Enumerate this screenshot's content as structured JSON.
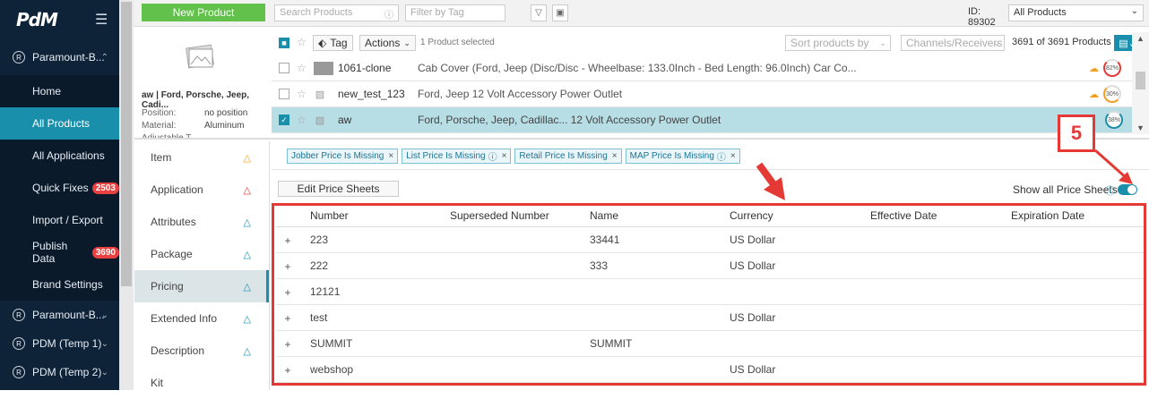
{
  "brand": {
    "logo": "PdM"
  },
  "sidebar": {
    "accounts": [
      {
        "label": "Paramount-B..."
      },
      {
        "label": "Paramount-B..."
      },
      {
        "label": "PDM (Temp 1)"
      },
      {
        "label": "PDM (Temp 2)"
      }
    ],
    "items": [
      {
        "label": "Home"
      },
      {
        "label": "All Products"
      },
      {
        "label": "All Applications"
      },
      {
        "label": "Quick Fixes",
        "badge": "2503"
      },
      {
        "label": "Import / Export"
      },
      {
        "label": "Publish Data",
        "badge": "3690"
      },
      {
        "label": "Brand Settings"
      }
    ]
  },
  "topbar": {
    "new_product": "New Product",
    "search_placeholder": "Search Products",
    "filter_placeholder": "Filter by Tag",
    "id_label": "ID: 89302",
    "scope": "All Products"
  },
  "toolbar": {
    "tag": "Tag",
    "actions": "Actions",
    "selected": "1 Product selected",
    "sort": "Sort products by",
    "channels": "Channels/Receivers",
    "count": "3691 of 3691 Products"
  },
  "preview": {
    "title": "aw | Ford, Porsche, Jeep, Cadi...",
    "position_label": "Position:",
    "position_value": "no position",
    "material_label": "Material:",
    "material_value": "Aluminum",
    "adj_label": "Adjustable T..."
  },
  "products": [
    {
      "name": "1061-clone",
      "desc": "Cab Cover (Ford, Jeep (Disc/Disc - Wheelbase: 133.0Inch - Bed Length: 96.0Inch) Car Co...",
      "score": "82%"
    },
    {
      "name": "new_test_123",
      "desc": "Ford, Jeep 12 Volt Accessory Power Outlet",
      "score": "30%"
    },
    {
      "name": "aw",
      "desc": "Ford, Porsche, Jeep, Cadillac... 12 Volt Accessory Power Outlet",
      "score": "38%"
    }
  ],
  "tabs": [
    {
      "label": "Item"
    },
    {
      "label": "Application"
    },
    {
      "label": "Attributes"
    },
    {
      "label": "Package"
    },
    {
      "label": "Pricing"
    },
    {
      "label": "Extended Info"
    },
    {
      "label": "Description"
    },
    {
      "label": "Kit"
    }
  ],
  "chips": [
    {
      "label": "Jobber Price Is Missing"
    },
    {
      "label": "List Price Is Missing"
    },
    {
      "label": "Retail Price Is Missing"
    },
    {
      "label": "MAP Price Is Missing"
    }
  ],
  "pricing": {
    "edit_button": "Edit Price Sheets",
    "show_all": "Show all Price Sheets",
    "headers": [
      "Number",
      "Superseded Number",
      "Name",
      "Currency",
      "Effective Date",
      "Expiration Date"
    ],
    "rows": [
      {
        "number": "223",
        "superseded": "",
        "name": "33441",
        "currency": "US Dollar"
      },
      {
        "number": "222",
        "superseded": "",
        "name": "333",
        "currency": "US Dollar"
      },
      {
        "number": "12121",
        "superseded": "",
        "name": "",
        "currency": ""
      },
      {
        "number": "test",
        "superseded": "",
        "name": "",
        "currency": "US Dollar"
      },
      {
        "number": "SUMMIT",
        "superseded": "",
        "name": "SUMMIT",
        "currency": ""
      },
      {
        "number": "webshop",
        "superseded": "",
        "name": "",
        "currency": "US Dollar"
      }
    ]
  },
  "annotation": {
    "step": "5"
  },
  "colors": {
    "accent": "#1a8fab",
    "green": "#62c14a",
    "red": "#e53935",
    "sidebar": "#0e2238"
  }
}
